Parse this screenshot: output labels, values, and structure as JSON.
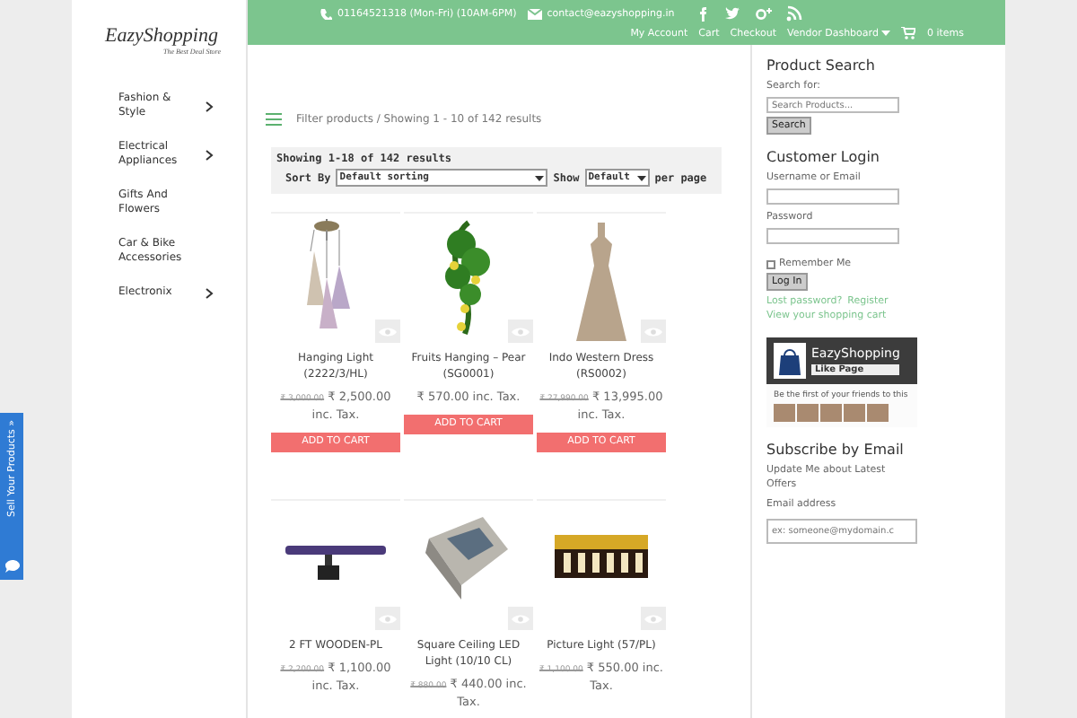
{
  "logo": {
    "name": "EazyShopping",
    "tagline": "The Best Deal Store"
  },
  "topbar": {
    "phone": "01164521318 (Mon-Fri) (10AM-6PM)",
    "email": "contact@eazyshopping.in",
    "social": [
      {
        "kind": "facebook"
      },
      {
        "kind": "twitter"
      },
      {
        "kind": "googleplus"
      },
      {
        "kind": "rss"
      }
    ],
    "links": [
      {
        "label": "My Account",
        "dropdown": false
      },
      {
        "label": "Cart",
        "dropdown": false
      },
      {
        "label": "Checkout",
        "dropdown": false
      },
      {
        "label": "Vendor Dashboard",
        "dropdown": true
      }
    ],
    "cart": "0 items"
  },
  "categories": [
    {
      "label": "Fashion & Style",
      "has_submenu": true
    },
    {
      "label": "Electrical Appliances",
      "has_submenu": true
    },
    {
      "label": "Gifts And Flowers",
      "has_submenu": false
    },
    {
      "label": "Car & Bike Accessories",
      "has_submenu": false
    },
    {
      "label": "Electronix",
      "has_submenu": true
    }
  ],
  "filter": {
    "label": "Filter products / Showing 1 - 10 of 142 results"
  },
  "ordering": {
    "count": "Showing 1-18 of 142 results",
    "sort_label": "Sort By",
    "sort_value": "Default sorting",
    "show_label": "Show",
    "show_value": "Default",
    "per_page": "per page"
  },
  "products": [
    {
      "kind": "lamp",
      "name": "Hanging Light (2222/3/HL)",
      "old_price": "₹ 3,000.00",
      "price": "₹ 2,500.00 inc. Tax.",
      "button": "ADD TO CART"
    },
    {
      "kind": "plant",
      "name": "Fruits Hanging – Pear (SG0001)",
      "price": "₹ 570.00 inc. Tax.",
      "button": "ADD TO CART"
    },
    {
      "kind": "dress",
      "name": "Indo Western Dress (RS0002)",
      "old_price": "₹ 27,990.00",
      "price": "₹ 13,995.00 inc. Tax.",
      "button": "ADD TO CART"
    },
    {
      "kind": "bar",
      "name": "2 FT WOODEN-PL",
      "old_price": "₹ 2,200.00",
      "price": "₹ 1,100.00 inc. Tax."
    },
    {
      "kind": "box",
      "name": "Square Ceiling LED Light (10/10 CL)",
      "old_price": "₹ 880.00",
      "price": "₹ 440.00 inc. Tax."
    },
    {
      "kind": "gold",
      "name": "Picture Light (57/PL)",
      "old_price": "₹ 1,100.00",
      "price": "₹ 550.00 inc. Tax."
    }
  ],
  "sidebar": {
    "search_title": "Product Search",
    "search_label": "Search for:",
    "search_placeholder": "Search Products...",
    "search_button": "Search",
    "login_title": "Customer Login",
    "username_label": "Username or Email",
    "password_label": "Password",
    "remember_label": "Remember Me",
    "remember_checked": false,
    "login_button": "Log In",
    "lost_password": "Lost password?",
    "register": "Register",
    "view_cart": "View your shopping cart",
    "fb_page": "EazyShopping",
    "fb_like": "Like Page",
    "fb_friends": "Be the first of your friends to this",
    "subscribe_title": "Subscribe by Email",
    "subscribe_text": "Update Me about Latest Offers",
    "email_label": "Email address",
    "email_placeholder": "ex: someone@mydomain.c"
  },
  "side_tab": {
    "label": "Sell Your Products »"
  }
}
